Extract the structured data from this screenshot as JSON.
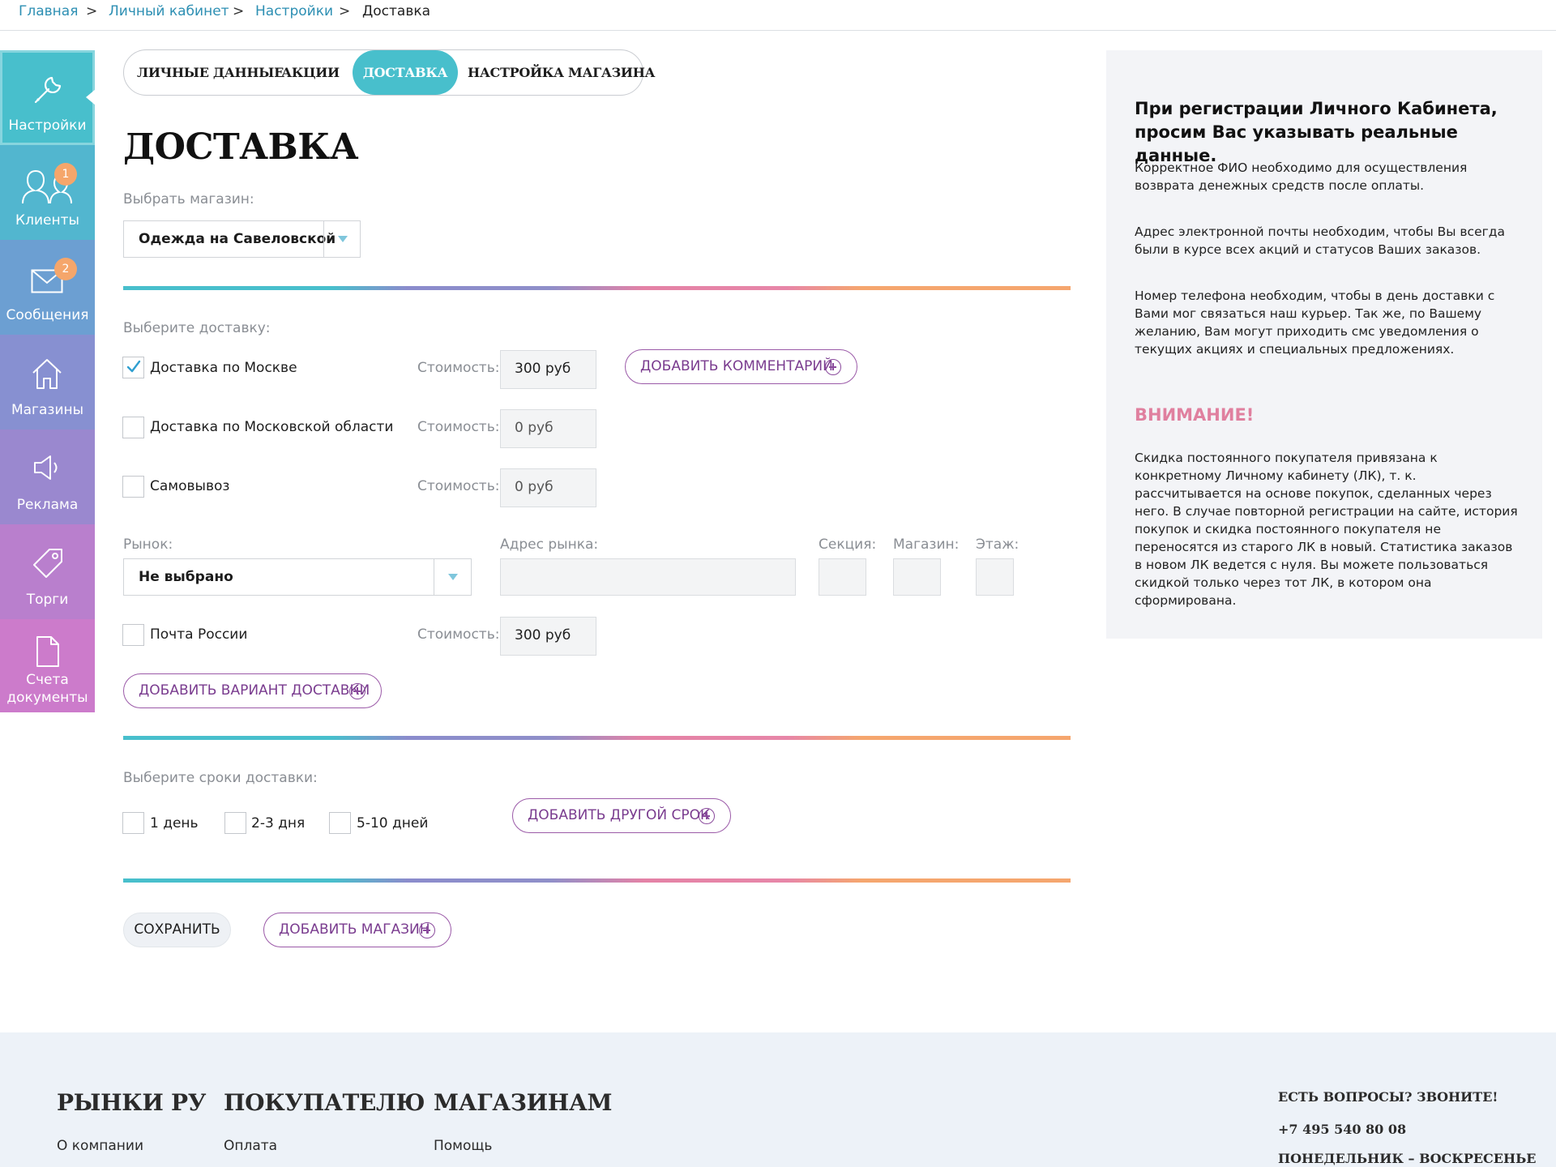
{
  "breadcrumb": {
    "items": [
      "Главная",
      "Личный кабинет",
      "Настройки"
    ],
    "separator": ">",
    "current": "Доставка"
  },
  "sidebar": {
    "items": [
      {
        "label": "Настройки",
        "icon": "wrench-icon",
        "color": "#48bfcc",
        "active": true
      },
      {
        "label": "Клиенты",
        "icon": "users-icon",
        "color": "#52b6cf",
        "badge": "1"
      },
      {
        "label": "Сообщения",
        "icon": "envelope-icon",
        "color": "#6c9fd2",
        "badge": "2"
      },
      {
        "label": "Магазины",
        "icon": "home-icon",
        "color": "#8790d1"
      },
      {
        "label": "Реклама",
        "icon": "megaphone-icon",
        "color": "#9a88cf"
      },
      {
        "label": "Торги",
        "icon": "tag-icon",
        "color": "#b97fcd"
      },
      {
        "label_line1": "Счета",
        "label_line2": "документы",
        "icon": "document-icon",
        "color": "#cc7bcb"
      }
    ]
  },
  "tabs": [
    "ЛИЧНЫЕ ДАННЫЕ",
    "АКЦИИ",
    "ДОСТАВКА",
    "НАСТРОЙКА МАГАЗИНА"
  ],
  "active_tab": "ДОСТАВКА",
  "page_title": "ДОСТАВКА",
  "store_select": {
    "label": "Выбрать магазин:",
    "value": "Одежда на Савеловской"
  },
  "delivery": {
    "label": "Выберите доставку:",
    "cost_label": "Стоимость:",
    "options": [
      {
        "label": "Доставка по Москве",
        "checked": true,
        "cost": "300 руб"
      },
      {
        "label": "Доставка по Московской области",
        "checked": false,
        "cost": "0 руб"
      },
      {
        "label": "Самовывоз",
        "checked": false,
        "cost": "0 руб"
      },
      {
        "label": "Почта России",
        "checked": false,
        "cost": "300 руб"
      }
    ],
    "add_comment": "ДОБАВИТЬ КОММЕНТАРИЙ",
    "add_variant": "ДОБАВИТЬ ВАРИАНТ ДОСТАВКИ"
  },
  "market": {
    "label": "Рынок:",
    "value": "Не выбрано",
    "address_label": "Адрес рынка:",
    "section_label": "Секция:",
    "shop_label": "Магазин:",
    "floor_label": "Этаж:"
  },
  "terms": {
    "label": "Выберите сроки доставки:",
    "options": [
      "1 день",
      "2-3 дня",
      "5-10 дней"
    ],
    "add_term": "ДОБАВИТЬ ДРУГОЙ СРОК"
  },
  "actions": {
    "save": "СОХРАНИТЬ",
    "add_store": "ДОБАВИТЬ МАГАЗИН"
  },
  "info": {
    "title": "При регистрации Личного Кабинета, просим Вас указывать реальные данные.",
    "p1": "Корректное ФИО необходимо для осуществления возврата денежных средств после оплаты.",
    "p2": "Адрес электронной почты необходим, чтобы Вы всегда были в курсе всех акций и статусов Ваших заказов.",
    "p3": "Номер телефона необходим, чтобы в день доставки с Вами мог связаться наш курьер. Так же, по Вашему желанию, Вам могут приходить смс уведомления о текущих акциях и специальных предложениях.",
    "warning": "ВНИМАНИЕ!",
    "p4": "Скидка постоянного покупателя привязана к конкретному Личному кабинету (ЛК), т. к. рассчитывается на основе покупок, сделанных через него. В случае повторной регистрации на сайте, история покупок и скидка постоянного покупателя не переносятся из старого ЛК в новый. Статистика заказов в новом ЛК ведется с нуля. Вы можете пользоваться скидкой только через тот ЛК, в котором она сформирована."
  },
  "footer": {
    "col1": {
      "title": "РЫНКИ РУ",
      "link": "О компании"
    },
    "col2": {
      "title": "ПОКУПАТЕЛЮ",
      "link": "Оплата"
    },
    "col3": {
      "title": "МАГАЗИНАМ",
      "link": "Помощь"
    },
    "contact": {
      "title": "ЕСТЬ ВОПРОСЫ? ЗВОНИТЕ!",
      "phone": "+7 495 540 80 08",
      "hours": "ПОНЕДЕЛЬНИК – ВОСКРЕСЕНЬЕ"
    }
  },
  "colors": {
    "accent": "#48bfcc",
    "purple_button": "#9b5aa8",
    "warning": "#e0809f"
  }
}
